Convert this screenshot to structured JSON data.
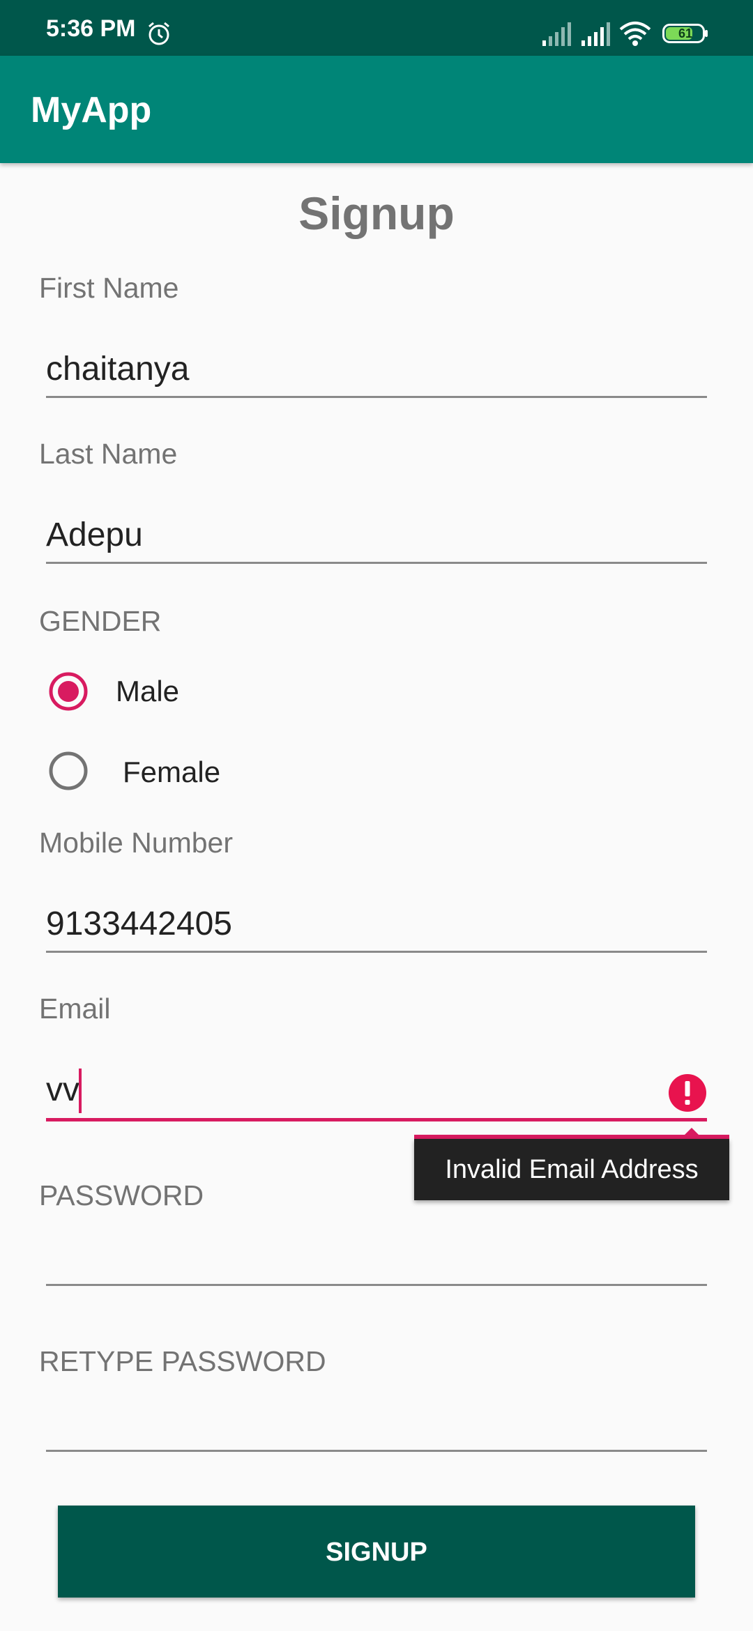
{
  "status_bar": {
    "time": "5:36 PM",
    "battery": "61",
    "icons": [
      "alarm-icon",
      "signal-icon",
      "signal-icon",
      "wifi-icon",
      "battery-icon"
    ]
  },
  "app_bar": {
    "title": "MyApp"
  },
  "form": {
    "title": "Signup",
    "first_name": {
      "label": "First Name",
      "value": "chaitanya"
    },
    "last_name": {
      "label": "Last Name",
      "value": "Adepu"
    },
    "gender": {
      "label": "GENDER",
      "options": [
        {
          "label": "Male",
          "selected": true
        },
        {
          "label": "Female",
          "selected": false
        }
      ]
    },
    "mobile": {
      "label": "Mobile Number",
      "value": "9133442405"
    },
    "email": {
      "label": "Email",
      "value": "vv",
      "error": "Invalid Email Address"
    },
    "password": {
      "label": "PASSWORD",
      "value": ""
    },
    "retype_password": {
      "label": "RETYPE PASSWORD",
      "value": ""
    },
    "submit_label": "SIGNUP"
  },
  "colors": {
    "status_bar": "#00574b",
    "app_bar": "#008577",
    "accent": "#d81b60",
    "button": "#00574b",
    "error": "#e8134e"
  }
}
